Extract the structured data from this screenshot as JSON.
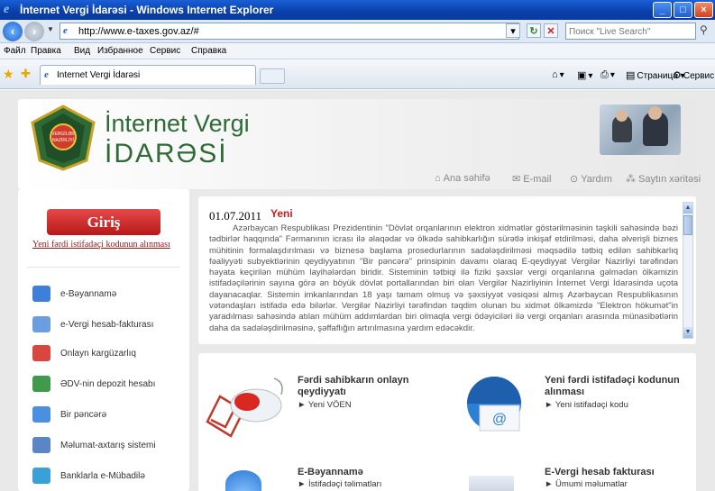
{
  "browser": {
    "title": "İnternet Vergi İdarəsi - Windows Internet Explorer",
    "url": "http://www.e-taxes.gov.az/#",
    "search_placeholder": "Поиск \"Live Search\"",
    "menu": [
      "Файл",
      "Правка",
      "Вид",
      "Избранное",
      "Сервис",
      "Справка"
    ],
    "tab_label": "Internet Vergi İdarəsi",
    "page_menu": "Страница",
    "tools_menu": "Сервис"
  },
  "site": {
    "brand_line1": "İnternet Vergi",
    "brand_line2": "İDARƏSİ",
    "emblem_text": "VERGİLƏR NAZİRLİYİ",
    "top_links": [
      "Ana səhifə",
      "E-mail",
      "Yardım",
      "Saytın xəritəsi"
    ]
  },
  "sidebar": {
    "login": "Giriş",
    "new_code_link": "Yeni fərdi istifadəçi kodunun alınması",
    "items": [
      {
        "label": "e-Bəyannamə",
        "color": "#3d7fd9"
      },
      {
        "label": "e-Vergi hesab-fakturası",
        "color": "#6a9ee0"
      },
      {
        "label": "Onlayn kargüzarlıq",
        "color": "#d9463d"
      },
      {
        "label": "ƏDV-nin depozit hesabı",
        "color": "#3f9a4a"
      },
      {
        "label": "Bir pəncərə",
        "color": "#4a8fe0"
      },
      {
        "label": "Məlumat-axtarış sistemi",
        "color": "#5a86c9"
      },
      {
        "label": "Banklarla e-Mübadilə",
        "color": "#3aa0d8"
      }
    ]
  },
  "announcement": {
    "date": "01.07.2011",
    "badge": "Yeni",
    "text": "Azərbaycan Respublikası Prezidentinin \"Dövlət orqanlarının elektron xidmətlər göstərilməsinin təşkili sahəsində bəzi tədbirlər haqqında\" Fərmanının icrası ilə əlaqədar və ölkədə sahibkarlığın sürətlə inkişaf etdirilməsi, daha əlverişli biznes mühitinin formalaşdırılması və biznesə başlama prosedurlarının sadələşdirilməsi məqsədilə tətbiq edilən sahibkarlıq fəaliyyəti subyektlərinin qeydiyyatının \"Bir pəncərə\" prinsipinin davamı olaraq E-qeydiyyat Vergilər Nazirliyi tərəfindən həyata keçirilən mühüm layihələrdən biridir. Sisteminin tətbiqi ilə fiziki şəxslər vergi orqanlarına gəlmədən ölkəmizin istifadəçilərinin sayına görə ən böyük dövlət portallarından biri olan Vergilər Nazirliyinin İnternet Vergi İdarəsində uçota dayanacaqlar. Sistemin imkanlarından 18 yaşı tamam olmuş və şəxsiyyət vəsiqəsi almış Azərbaycan Respublikasının vətəndaşları istifadə edə bilərlər. Vergilər Nazirliyi tərəfindən təqdim olunan bu xidmət ölkəmizdə \"Elektron hökumət\"in yaradılması sahəsində atılan mühüm addımlardan biri olmaqla vergi ödəyiciləri ilə vergi orqanları arasında münasibətlərin daha da sadələşdirilməsinə, şəffaflığın artırılmasına yardım edəcəkdir."
  },
  "services": [
    {
      "title": "Fərdi sahibkarın onlayn qeydiyyatı",
      "link": "Yeni VÖEN"
    },
    {
      "title": "Yeni fərdi istifadəçi kodunun alınması",
      "link": "Yeni istifadəçi kodu"
    },
    {
      "title": "E-Bəyannamə",
      "link": "İstifadəçi təlimatları"
    },
    {
      "title": "E-Vergi hesab fakturası",
      "link": "Ümumi məlumatlar"
    }
  ]
}
